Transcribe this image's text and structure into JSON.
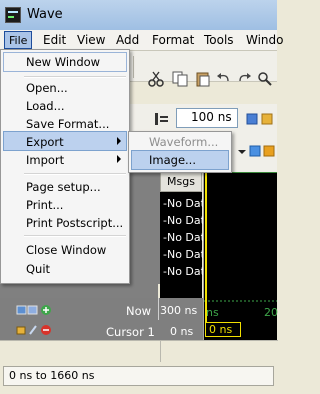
{
  "window": {
    "title": "Wave"
  },
  "menubar": {
    "items": [
      "File",
      "Edit",
      "View",
      "Add",
      "Format",
      "Tools",
      "Windo"
    ]
  },
  "toolbar": {
    "time_value": "100 ns"
  },
  "file_menu": {
    "new_window": "New Window",
    "open": "Open...",
    "load": "Load...",
    "save_format": "Save Format...",
    "export": "Export",
    "import": "Import",
    "page_setup": "Page setup...",
    "print": "Print...",
    "print_postscript": "Print Postscript...",
    "close_window": "Close Window",
    "quit": "Quit"
  },
  "export_submenu": {
    "waveform": "Waveform...",
    "image": "Image..."
  },
  "wave": {
    "msgs_header": "Msgs",
    "values": [
      "-No Data",
      "-No Data",
      "-No Data",
      "-No Data",
      "-No Data"
    ],
    "now_label": "Now",
    "now_value": "300 ns",
    "cursor_label": "Cursor 1",
    "cursor_value": "0 ns",
    "ruler_label": "ns",
    "ruler_tick": "20",
    "cursor_flag": "0 ns"
  },
  "status": {
    "range": "0 ns to 1660 ns"
  },
  "colors": {
    "wave_background": "#000000",
    "cursor_line": "#f2e000",
    "selection": "#bcd1ee"
  }
}
